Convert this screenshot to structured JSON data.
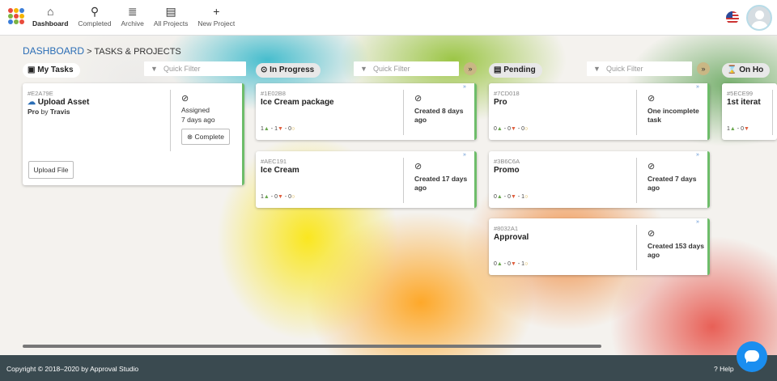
{
  "nav": {
    "items": [
      {
        "label": "Dashboard",
        "icon": "home-icon",
        "glyph": "⌂"
      },
      {
        "label": "Completed",
        "icon": "search-icon",
        "glyph": "⚲"
      },
      {
        "label": "Archive",
        "icon": "database-icon",
        "glyph": "≣"
      },
      {
        "label": "All Projects",
        "icon": "list-window-icon",
        "glyph": "▤"
      },
      {
        "label": "New Project",
        "icon": "plus-icon",
        "glyph": "+"
      }
    ],
    "active": "Dashboard"
  },
  "breadcrumb": {
    "link": "DASHBOARD",
    "sep": ">",
    "current": "TASKS & PROJECTS"
  },
  "columns": {
    "my_tasks": {
      "title": "My Tasks",
      "filter_placeholder": "Quick Filter",
      "icon": "task-list-icon",
      "glyph": "▣"
    },
    "in_progress": {
      "title": "In Progress",
      "filter_placeholder": "Quick Filter",
      "icon": "progress-icon",
      "glyph": "⊙"
    },
    "pending": {
      "title": "Pending",
      "filter_placeholder": "Quick Filter",
      "icon": "pending-icon",
      "glyph": "▤"
    },
    "on_hold": {
      "title": "On Ho",
      "icon": "hourglass-icon",
      "glyph": "⌛"
    }
  },
  "cards": {
    "my_task_1": {
      "id": "#E2A79E",
      "title": "Upload Asset",
      "sub_prefix": "Pro",
      "sub_by": "by",
      "sub_user": "Travis",
      "status_label": "Assigned",
      "status_time": "7 days ago",
      "complete_label": "Complete",
      "upload_label": "Upload File"
    },
    "ip1": {
      "id": "#1E02B8",
      "title": "Ice Cream package",
      "status1": "Created 8 days",
      "status2": "ago",
      "up": "1",
      "down": "1",
      "neutral": "0"
    },
    "ip2": {
      "id": "#AEC191",
      "title": "Ice Cream",
      "status1": "Created 17 days",
      "status2": "ago",
      "up": "1",
      "down": "0",
      "neutral": "0"
    },
    "pd1": {
      "id": "#7CD018",
      "title": "Pro",
      "status1": "One incomplete",
      "status2": "task",
      "up": "0",
      "down": "0",
      "neutral": "0"
    },
    "pd2": {
      "id": "#3B6C6A",
      "title": "Promo",
      "status1": "Created 7 days",
      "status2": "ago",
      "up": "0",
      "down": "0",
      "neutral": "1"
    },
    "pd3": {
      "id": "#8032A1",
      "title": "Approval",
      "status1": "Created 153 days",
      "status2": "ago",
      "up": "0",
      "down": "0",
      "neutral": "1"
    },
    "oh1": {
      "id": "#5ECE99",
      "title": "1st iterat",
      "up": "1",
      "down": "0"
    }
  },
  "footer": {
    "copyright": "Copyright © 2018–2020 by Approval Studio",
    "help": "Help"
  },
  "colors": {
    "accent": "#2a6db5",
    "card_border": "#6ebd6a",
    "footer": "#3a4a50",
    "chat": "#1a8ef0"
  }
}
